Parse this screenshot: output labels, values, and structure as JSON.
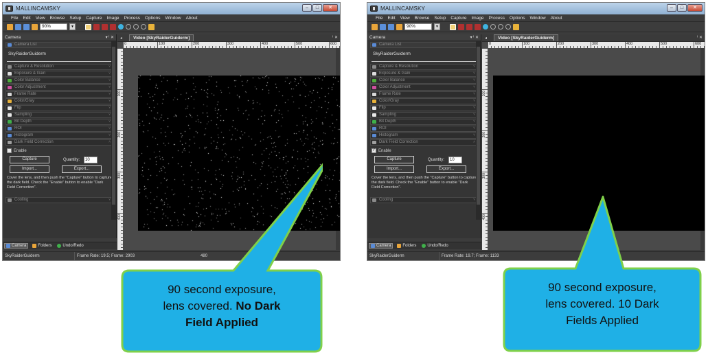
{
  "app": {
    "title": "MALLINCAMSKY"
  },
  "menu": [
    "File",
    "Edit",
    "View",
    "Browse",
    "Setup",
    "Capture",
    "Image",
    "Process",
    "Options",
    "Window",
    "About"
  ],
  "toolbar": {
    "zoom_value": "90%"
  },
  "panel": {
    "title": "Camera",
    "pin_controls": "▾ ᴵ ✕",
    "camera_list_label": "Camera List",
    "camera_name": "SkyRaiderGuiderm",
    "sections": [
      {
        "label": "Capture & Resolution",
        "color": "#8a8a8a"
      },
      {
        "label": "Exposure & Gain",
        "color": "#dddddd"
      },
      {
        "label": "Color Balance",
        "color": "#4fae3b"
      },
      {
        "label": "Color Adjustment",
        "color": "#d04fa0"
      },
      {
        "label": "Frame Rate",
        "color": "#d8d8d8"
      },
      {
        "label": "Color/Gray",
        "color": "#e8b23a"
      },
      {
        "label": "Flip",
        "color": "#e8e8e8"
      },
      {
        "label": "Sampling",
        "color": "#e8e8e8"
      },
      {
        "label": "Bit Depth",
        "color": "#3fb04a"
      },
      {
        "label": "ROI",
        "color": "#5a8bd6"
      },
      {
        "label": "Histogram",
        "color": "#5a8bd6"
      },
      {
        "label": "Dark Field Correction",
        "color": "#a0a0a0"
      }
    ],
    "enable_label": "Enable",
    "capture_button": "Capture",
    "quantity_label": "Quantity:",
    "quantity_value": "10",
    "import_button": "Import...",
    "export_button": "Export...",
    "help_text": "Cover the lens, and then push the \"Capture\" button to capture the dark field. Check the \"Enable\" button to enable \"Dark Field Correction\".",
    "cooling_label": "Cooling"
  },
  "bottom_tabs": [
    "Camera",
    "Folders",
    "Undo/Redo"
  ],
  "doc": {
    "tab_label": "Video [SkyRaiderGuiderm]",
    "pin_controls": "ᴵ ✕",
    "ruler_h": [
      "0",
      "100",
      "200",
      "300",
      "400",
      "500",
      "600"
    ],
    "ruler_v": [
      "100",
      "200",
      "300",
      "400"
    ]
  },
  "left_window": {
    "enable_checked": false,
    "status_camera": "SkyRaiderGuiderm",
    "status_frame": "Frame Rate: 19.5; Frame: 2903",
    "status_extra": "480"
  },
  "right_window": {
    "enable_checked": true,
    "status_camera": "SkyRaiderGuiderm",
    "status_frame": "Frame Rate: 19.7; Frame: 1133",
    "status_extra": ""
  },
  "callouts": {
    "left": {
      "line1": "90 second exposure,",
      "line2_plain": "lens covered. ",
      "line2_bold": "No Dark",
      "line3_bold": "Field Applied"
    },
    "right": {
      "line1": "90 second exposure,",
      "line2": "lens covered. 10 Dark",
      "line3": "Fields Applied"
    }
  },
  "colors": {
    "callout_fill": "#1fb0e6",
    "callout_border": "#7fd04a",
    "video_bg": "#000000"
  }
}
